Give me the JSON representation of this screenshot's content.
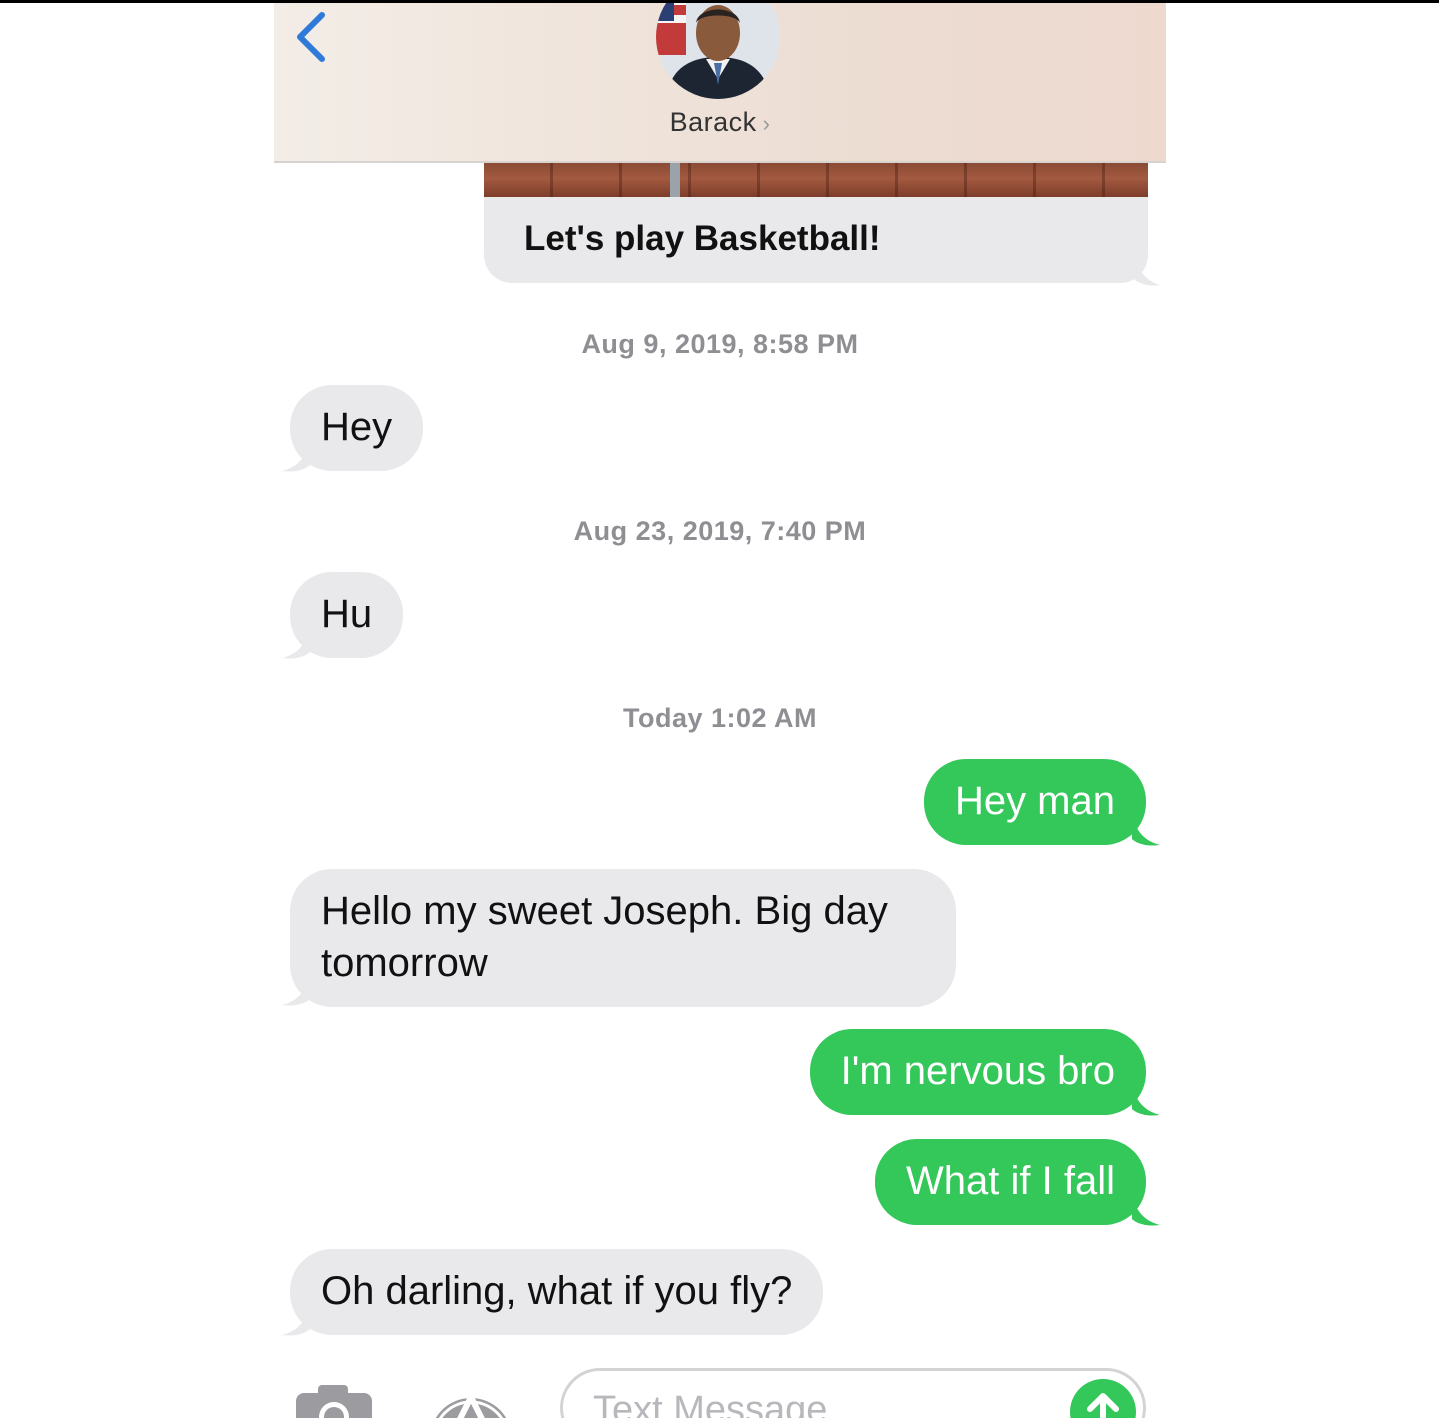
{
  "header": {
    "contact_name": "Barack",
    "contact_chevron": "›",
    "back_icon": "chevron-left-icon",
    "accent": "#2f7ad9"
  },
  "link_preview": {
    "title": "Let's play Basketball!"
  },
  "conversation": {
    "timestamps": [
      "Aug 9, 2019, 8:58 PM",
      "Aug 23, 2019, 7:40 PM",
      "Today 1:02 AM"
    ],
    "messages": [
      {
        "from": "them",
        "text": "Hey"
      },
      {
        "from": "them",
        "text": "Hu"
      },
      {
        "from": "me",
        "text": "Hey man"
      },
      {
        "from": "them",
        "text": "Hello my sweet Joseph. Big day"
      },
      {
        "from": "them",
        "text": "tomorrow"
      },
      {
        "from": "me",
        "text": "I'm nervous bro"
      },
      {
        "from": "me",
        "text": "What if I fall"
      },
      {
        "from": "them",
        "text": "Oh darling, what if you fly?"
      }
    ]
  },
  "input_bar": {
    "placeholder": "Text Message",
    "camera_icon": "camera-icon",
    "appstore_icon": "app-store-icon",
    "send_icon": "arrow-up-icon"
  },
  "colors": {
    "sent_bubble": "#34c759",
    "received_bubble": "#e9e9eb",
    "timestamp": "#8e8e93"
  }
}
